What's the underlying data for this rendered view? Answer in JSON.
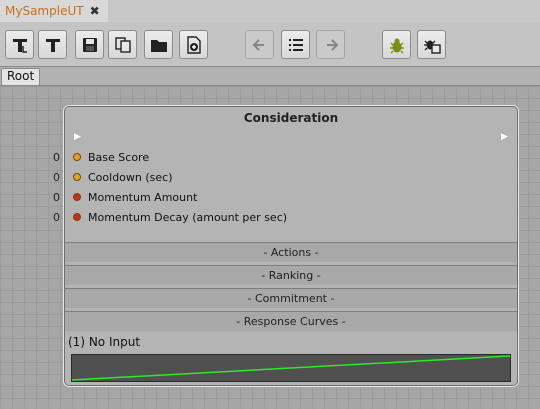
{
  "window": {
    "tab_title": "MySampleUT",
    "close_glyph": "✖"
  },
  "toolbar": {
    "buttons": [
      {
        "name": "new-ai-icon",
        "disabled": false
      },
      {
        "name": "text-tool-icon",
        "disabled": false
      },
      {
        "name": "save-icon",
        "disabled": false
      },
      {
        "name": "copy-icon",
        "disabled": false
      },
      {
        "name": "open-folder-icon",
        "disabled": false
      },
      {
        "name": "add-file-icon",
        "disabled": false
      },
      {
        "name": "undo-icon",
        "disabled": true
      },
      {
        "name": "list-icon",
        "disabled": false
      },
      {
        "name": "redo-icon",
        "disabled": true
      },
      {
        "name": "debug-bug-icon",
        "disabled": false
      },
      {
        "name": "debug-window-icon",
        "disabled": false
      }
    ]
  },
  "breadcrumb": {
    "root": "Root"
  },
  "node": {
    "title": "Consideration",
    "inputs": [
      {
        "value": "0",
        "label": "Base Score",
        "color": "#e6a21c"
      },
      {
        "value": "0",
        "label": "Cooldown (sec)",
        "color": "#e6a21c"
      },
      {
        "value": "0",
        "label": "Momentum Amount",
        "color": "#d42a1c"
      },
      {
        "value": "0",
        "label": "Momentum Decay (amount per sec)",
        "color": "#d42a1c"
      }
    ],
    "sections": {
      "actions": "- Actions -",
      "ranking": "- Ranking -",
      "commitment": "- Commitment -",
      "response_curves": "- Response Curves -"
    },
    "curve": {
      "label": "(1)  No Input",
      "line_color": "#2ee82e"
    }
  }
}
